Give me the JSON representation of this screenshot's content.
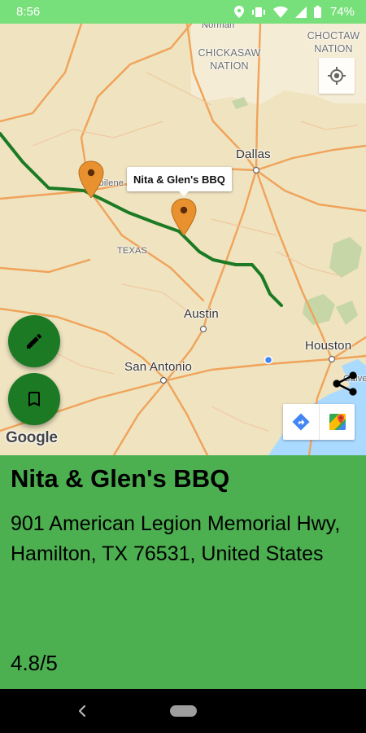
{
  "status_bar": {
    "time": "8:56",
    "battery": "74%",
    "icons": [
      "location-icon",
      "vibrate-icon",
      "wifi-icon",
      "signal-icon",
      "battery-icon"
    ]
  },
  "map": {
    "labels": {
      "choctaw": "CHOCTAW NATION",
      "chickasaw": "CHICKASAW NATION",
      "norman": "Norman",
      "dallas": "Dallas",
      "texas": "TEXAS",
      "austin": "Austin",
      "san_antonio": "San Antonio",
      "houston": "Houston",
      "abilene": "Abilene",
      "galveston": "Galve"
    },
    "info_window": "Nita & Glen's BBQ",
    "attribution": "Google",
    "colors": {
      "land": "#efe3c0",
      "road": "#f0a35a",
      "route": "#1b7a23",
      "pin": "#e8912e",
      "water": "#aadaff"
    }
  },
  "fabs": {
    "edit": "edit-icon",
    "bookmark": "bookmark-icon"
  },
  "details": {
    "name": "Nita & Glen's BBQ",
    "address": "901 American Legion Memorial Hwy, Hamilton, TX 76531, United States",
    "rating": "4.8/5"
  }
}
